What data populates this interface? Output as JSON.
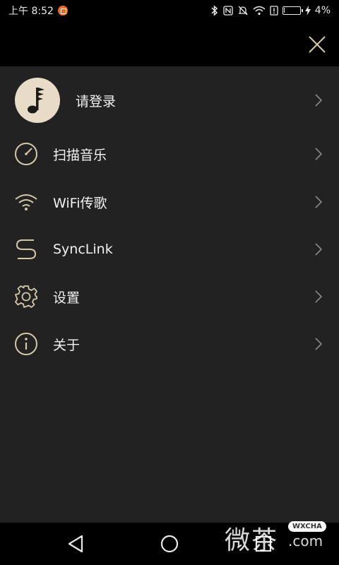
{
  "status_bar": {
    "time": "上午 8:52",
    "battery": "4%",
    "battery_level": 0.04
  },
  "menu": {
    "items": [
      {
        "label": "请登录",
        "icon": "music-note-avatar-icon"
      },
      {
        "label": "扫描音乐",
        "icon": "scan-gauge-icon"
      },
      {
        "label": "WiFi传歌",
        "icon": "wifi-icon"
      },
      {
        "label": "SyncLink",
        "icon": "synclink-s-icon"
      },
      {
        "label": "设置",
        "icon": "gear-icon"
      },
      {
        "label": "关于",
        "icon": "info-icon"
      }
    ]
  },
  "colors": {
    "accent": "#d6c7a8",
    "panel": "#222222",
    "bar": "#000000",
    "avatar_bg": "#e8dcc8"
  },
  "watermark": {
    "text": "微茶",
    "badge": "WXCHA",
    "domain": ".com"
  }
}
